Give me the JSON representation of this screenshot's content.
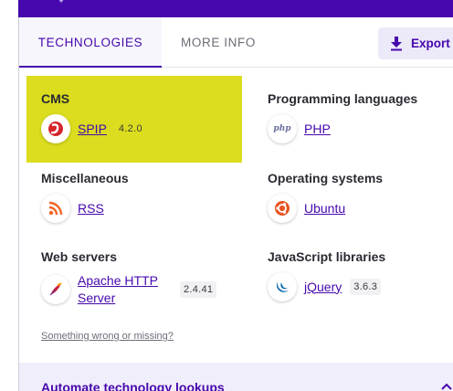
{
  "tabs": [
    {
      "label": "TECHNOLOGIES",
      "active": true
    },
    {
      "label": "MORE INFO",
      "active": false
    }
  ],
  "export_label": "Export",
  "categories": {
    "cms": {
      "title": "CMS",
      "items": [
        {
          "name": "SPIP",
          "version": "4.2.0",
          "icon": "spip-logo-icon"
        }
      ]
    },
    "programming_languages": {
      "title": "Programming languages",
      "items": [
        {
          "name": "PHP",
          "icon": "php-logo-icon",
          "icon_text": "php"
        }
      ]
    },
    "miscellaneous": {
      "title": "Miscellaneous",
      "items": [
        {
          "name": "RSS",
          "icon": "rss-icon"
        }
      ]
    },
    "operating_systems": {
      "title": "Operating systems",
      "items": [
        {
          "name": "Ubuntu",
          "icon": "ubuntu-logo-icon"
        }
      ]
    },
    "web_servers": {
      "title": "Web servers",
      "items": [
        {
          "name_line1": "Apache HTTP",
          "name_line2": "Server",
          "version": "2.4.41",
          "icon": "apache-feather-icon"
        }
      ]
    },
    "javascript_libraries": {
      "title": "JavaScript libraries",
      "items": [
        {
          "name": "jQuery",
          "version": "3.6.3",
          "icon": "jquery-logo-icon"
        }
      ]
    }
  },
  "report_link": "Something wrong or missing?",
  "bottom_panel_title": "Automate technology lookups",
  "colors": {
    "brand": "#4608ad",
    "highlight": "#dbdd1e",
    "panel_bg": "#f1eefb"
  }
}
